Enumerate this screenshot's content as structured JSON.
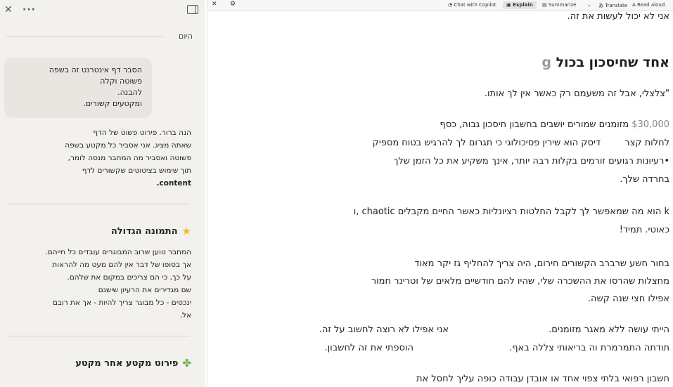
{
  "sidebar": {
    "today": "היום",
    "user_message": [
      "הסבר דף אינטרנט זה בשפה",
      "פשוטה וקלה",
      "להבנה.",
      "ומקטעים קשורים."
    ],
    "ai_intro": [
      "הנה ברור. פירוט פשוט של הדף",
      "שאתה מציג. אני אסביר כל מקטע בשפה",
      "פשוטה ואסביר מה המחבר מנסה לומר,",
      "תוך שימוש בציטוטים שקשורים לדף",
      "content."
    ],
    "section1_title": "התמונה הגדולה",
    "section1_lines": [
      "המחבר טוען שרוב המבוגרים עובדים כל חייהם.",
      "אך בסופו של דבר אין להם מעט מה להראות",
      "על כך, כי הם צריכים במקום את שלהם.",
      "שם מגדירים את הרעיון שישנם",
      "ינכסים - כל מבוגר צריך להיות - אך את רובם",
      "אל."
    ],
    "section2_title": "פירוט מקטע אחר מקטע"
  },
  "toolbar": {
    "read_aloud": "Read aloud",
    "translate": "Translate",
    "summarize": "Summarize",
    "explain": "Explain",
    "chat": "Chat with Copilot"
  },
  "article": {
    "line0": "אני לא יכול לעשות את זה.",
    "heading": "אחד שחיסכון בכול",
    "line1": "\"צלצלי, אבל זה משעמם רק כאשר אין לך אותו.",
    "line2a": "מזומנים שמורים יושבים בחשבון חיסכון גבוה, כסף",
    "line2b": "$30,000",
    "line3a": "דיסק הוא שירין פסיכולוגי כי תגרום לך להרגיש בטוח מספיק",
    "line3b": "לחלות קצר",
    "line4": "•רעיונות רגועים זורמים בקלות רבה יותר, אינך משקיע את כל הזמן שלך",
    "line5": "בחרדה שלך.",
    "line6": "k הוא מה שמאפשר לך לקבל החלטות רציונליות כאשר החיים מקבלים chaotic ,ו",
    "line7": "כאוטי. תמיד!",
    "line8": "בחור חשע שרברב הקשורים חירום, היה צריך להחליף גז יקר מאוד",
    "line9": "מחצלות שהרסו את ההשכרה שלי, שהיו להם חודשיים מלאים של וטרינר חמור",
    "line10": "אפילו חצי שנה קשה.",
    "line11a": "הייתי עושה ללא מאגר מזומנים.",
    "line11b": "אני אפילו לא רוצה לחשוב על זה.",
    "line12a": "תודתה התמרמרת וה בריאותי צללה באף.",
    "line12b": "הוספתי את זה לחשבון.",
    "line13": "חשבון רפואי בלתי צפוי אחד או אובדן עבודה כופה עליך לחסל את"
  }
}
